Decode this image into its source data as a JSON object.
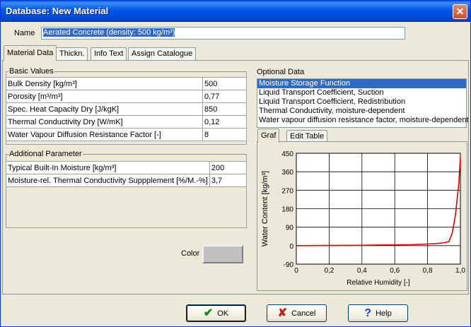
{
  "window": {
    "title": "Database: New Material",
    "close_glyph": "✕"
  },
  "name_field": {
    "label": "Name",
    "value": "Aerated Concrete (density: 500 kg/m³)"
  },
  "tabs": [
    {
      "label": "Material Data"
    },
    {
      "label": "Thickn."
    },
    {
      "label": "Info Text"
    },
    {
      "label": "Assign Catalogue"
    }
  ],
  "basic_values": {
    "title": "Basic Values",
    "rows": [
      {
        "label": "Bulk Density [kg/m³]",
        "value": "500"
      },
      {
        "label": "Porosity [m³/m³]",
        "value": "0,77"
      },
      {
        "label": "Spec. Heat Capacity Dry [J/kgK]",
        "value": "850"
      },
      {
        "label": "Thermal Conductivity Dry [W/mK]",
        "value": "0,12"
      },
      {
        "label": "Water Vapour Diffusion Resistance Factor [-]",
        "value": "8"
      }
    ]
  },
  "additional_parameter": {
    "title": "Additional Parameter",
    "rows": [
      {
        "label": "Typical Built-In Moisture [kg/m³]",
        "value": "200"
      },
      {
        "label": "Moisture-rel. Thermal Conductivity Suppplement [%/M.-%]",
        "value": "3,7"
      }
    ]
  },
  "color": {
    "label": "Color",
    "swatch": "#c0c0c0"
  },
  "optional_data": {
    "title": "Optional Data",
    "items": [
      "Moisture Storage Function",
      "Liquid Transport Coefficient, Suction",
      "Liquid Transport Coefficient, Redistribution",
      "Thermal Conductivity, moisture-dependent",
      "Water vapour diffusion resistance factor, moisture-dependent"
    ],
    "selected_index": 0
  },
  "chart_tabs": [
    {
      "label": "Graf"
    },
    {
      "label": "Edit Table"
    }
  ],
  "chart_data": {
    "type": "line",
    "xlabel": "Relative Humidity [-]",
    "ylabel": "Water Content  [kg/m³]",
    "xlim": [
      0,
      1
    ],
    "ylim": [
      -90,
      450
    ],
    "x_ticks": [
      "0",
      "0,2",
      "0,4",
      "0,6",
      "0,8",
      "1,0"
    ],
    "y_ticks": [
      "-90",
      "0",
      "90",
      "180",
      "270",
      "360",
      "450"
    ],
    "x_tick_values": [
      0,
      0.2,
      0.4,
      0.6,
      0.8,
      1.0
    ],
    "y_tick_values": [
      -90,
      0,
      90,
      180,
      270,
      360,
      450
    ],
    "grid": true,
    "series": [
      {
        "color": "#e00000",
        "x": [
          0,
          0.2,
          0.4,
          0.5,
          0.6,
          0.7,
          0.8,
          0.85,
          0.9,
          0.93,
          0.95,
          0.97,
          0.99,
          1.0
        ],
        "y": [
          0,
          1,
          2,
          3,
          4,
          5,
          8,
          10,
          14,
          20,
          60,
          150,
          300,
          430
        ]
      }
    ]
  },
  "buttons": {
    "ok": {
      "label": "OK",
      "icon": "check-icon",
      "color": "#0a8a0a"
    },
    "cancel": {
      "label": "Cancel",
      "icon": "x-icon",
      "color": "#c02020"
    },
    "help": {
      "label": "Help",
      "icon": "question-icon",
      "color": "#1a3fbf"
    }
  }
}
